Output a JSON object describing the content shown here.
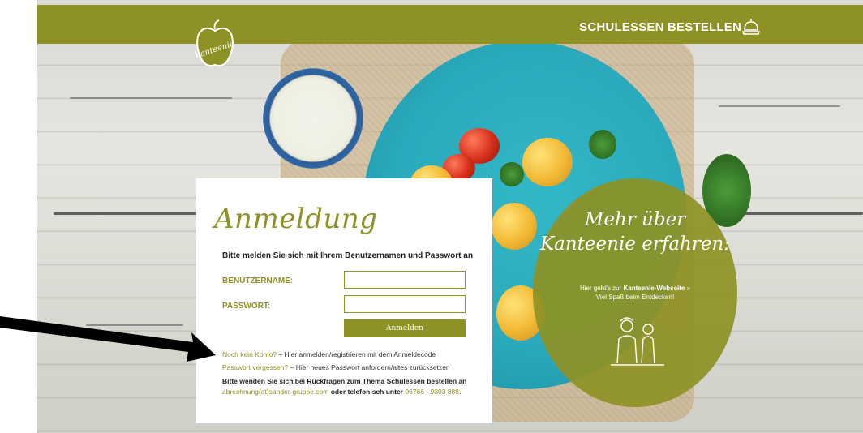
{
  "header": {
    "order_label": "SCHULESSEN BESTELLEN",
    "logo_text": "kanteenie",
    "brand_color": "#8e9124"
  },
  "login": {
    "title": "Anmeldung",
    "intro": "Bitte melden Sie sich mit Ihrem Benutzernamen und Passwort an",
    "username_label": "BENUTZERNAME:",
    "username_value": "",
    "password_label": "PASSWORT:",
    "password_value": "",
    "submit_label": "Anmelden",
    "register_link": "Noch kein Konto?",
    "register_text": " – Hier anmelden/registrieren mit dem Anmeldecode",
    "forgot_link": "Passwort vergessen?",
    "forgot_text": " – Hier neues Passwort anfordern/altes zurücksetzen",
    "contact_prefix": "Bitte wenden Sie sich bei Rückfragen zum Thema Schulessen bestellen an",
    "contact_email": "abrechnung(at)sander-gruppe.com",
    "contact_mid": " oder telefonisch unter ",
    "contact_phone": "06766 - 9303 888",
    "contact_end": "."
  },
  "info": {
    "title_line1": "Mehr über",
    "title_line2": "Kanteenie erfahren:",
    "text_prefix": "Hier geht's zur ",
    "text_link": "Kanteenie-Webseite",
    "text_suffix": " »",
    "text_line2": "Viel Spaß beim Entdecken!"
  },
  "icons": {
    "order": "cloche-icon",
    "logo": "apple-logo-icon",
    "illustration": "chefs-illustration-icon",
    "annotation": "arrow-pointer-icon"
  }
}
